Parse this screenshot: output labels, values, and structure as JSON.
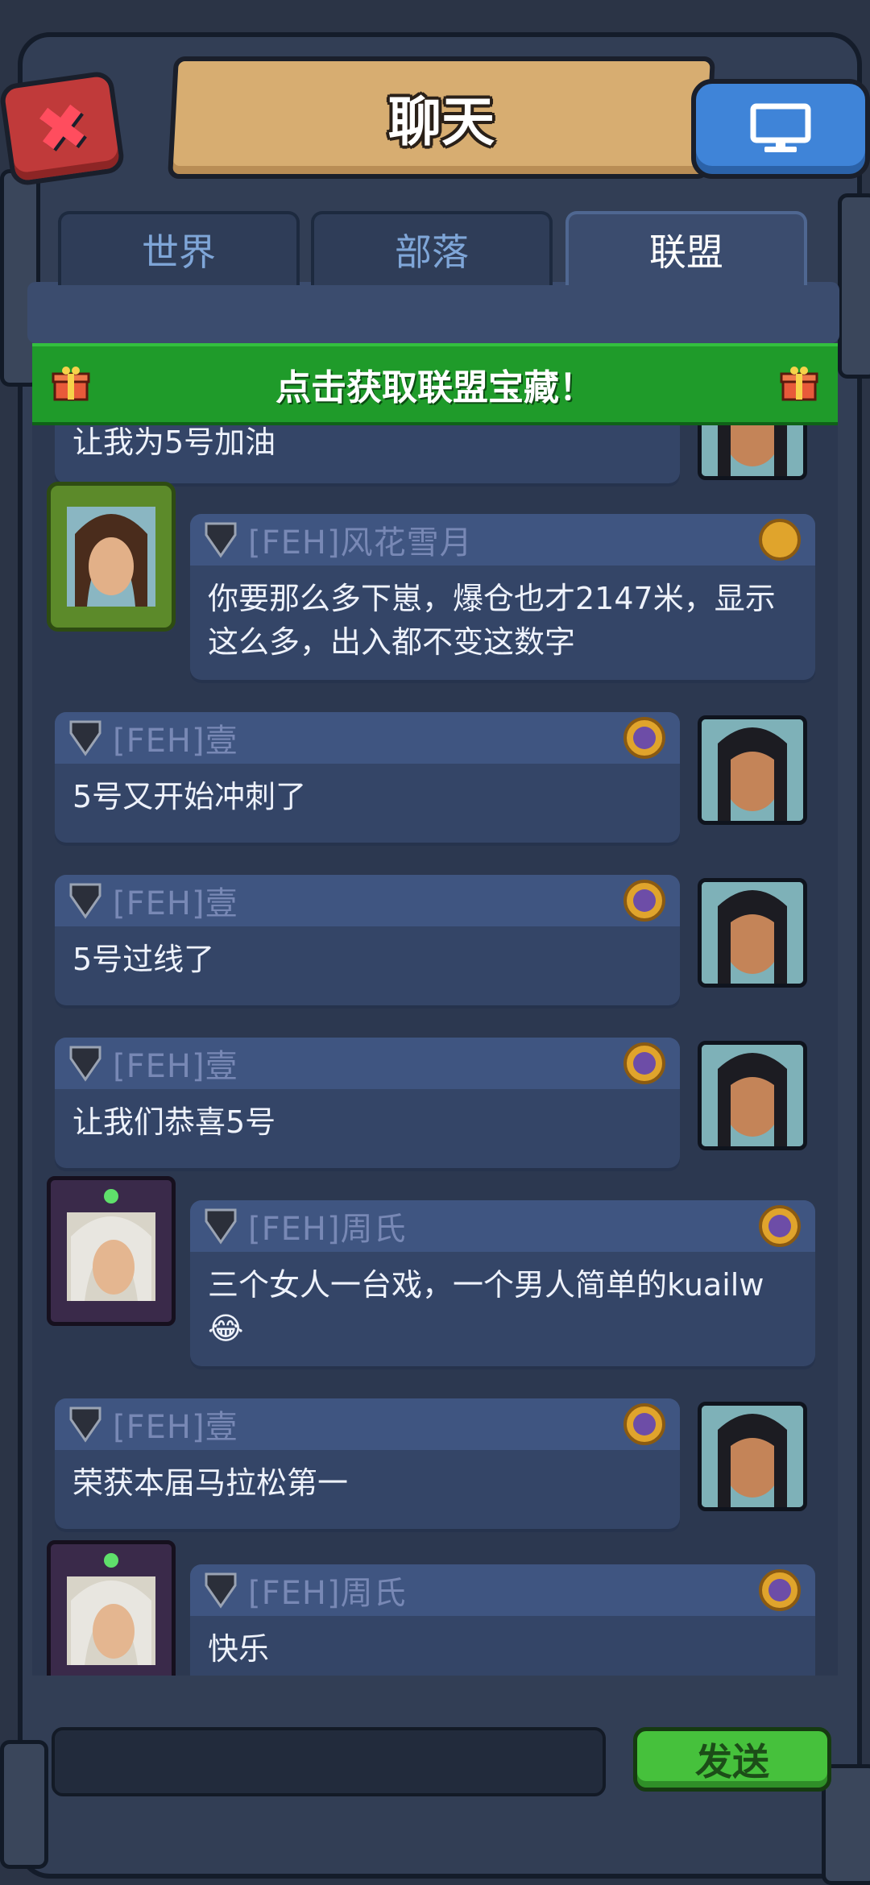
{
  "header": {
    "title": "聊天"
  },
  "tabs": [
    {
      "label": "世界"
    },
    {
      "label": "部落"
    },
    {
      "label": "联盟"
    }
  ],
  "banner": {
    "text": "点击获取联盟宝藏！"
  },
  "messages": [
    {
      "name": "",
      "text": "让我为5号加油",
      "side": "right"
    },
    {
      "name": "[FEH]风花雪月",
      "text": "你要那么多下崽，爆仓也才2147米，显示这么多，出入都不变这数字",
      "side": "left"
    },
    {
      "name": "[FEH]壹",
      "text": "5号又开始冲刺了",
      "side": "right"
    },
    {
      "name": "[FEH]壹",
      "text": "5号过线了",
      "side": "right"
    },
    {
      "name": "[FEH]壹",
      "text": "让我们恭喜5号",
      "side": "right"
    },
    {
      "name": "[FEH]周氏",
      "text": "三个女人一台戏，一个男人简单的kuailw😂",
      "side": "left"
    },
    {
      "name": "[FEH]壹",
      "text": "荣获本届马拉松第一",
      "side": "right"
    },
    {
      "name": "[FEH]周氏",
      "text": "快乐",
      "side": "left"
    }
  ],
  "input": {
    "value": "",
    "send_label": "发送"
  },
  "icons": {
    "close": "close-icon",
    "screen": "monitor-icon",
    "gift": "gift-icon",
    "rank": "rank-shield-icon",
    "badge": "badge-icon"
  },
  "colors": {
    "banner_green": "#1f9b2a",
    "send_green": "#46c13c",
    "close_red": "#c03a3a",
    "screen_blue": "#3f84d8"
  }
}
